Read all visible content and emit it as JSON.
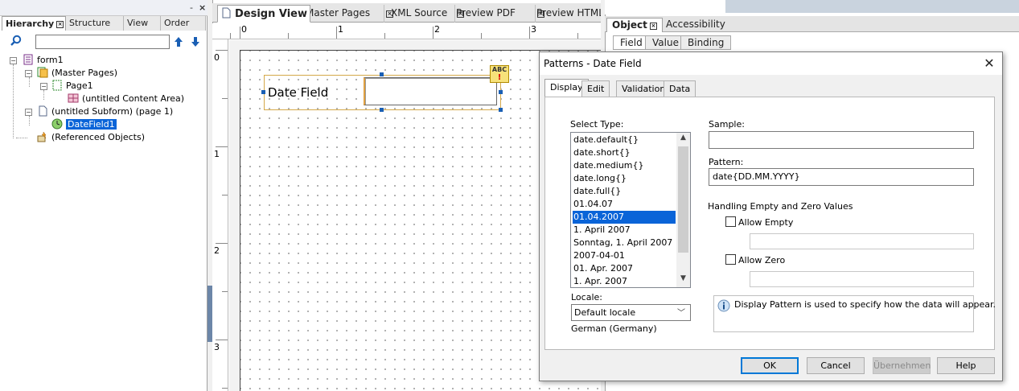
{
  "hierarchy_panel": {
    "tabs": [
      {
        "label": "Hierarchy"
      },
      {
        "label": "Structure"
      },
      {
        "label": "View"
      },
      {
        "label": "Order"
      }
    ],
    "minimize_label": "-",
    "close_label": "×",
    "tree": [
      {
        "label": "form1"
      },
      {
        "label": "(Master Pages)"
      },
      {
        "label": "Page1"
      },
      {
        "label": "(untitled Content Area)"
      },
      {
        "label": "(untitled Subform) (page 1)"
      },
      {
        "label": "DateField1"
      },
      {
        "label": "(Referenced Objects)"
      }
    ]
  },
  "design_panel": {
    "tabs": [
      {
        "label": "Design View"
      },
      {
        "label": "Master Pages"
      },
      {
        "label": "XML Source"
      },
      {
        "label": "Preview PDF"
      },
      {
        "label": "Preview HTML"
      }
    ],
    "ruler_h_labels": [
      "0",
      "1",
      "2",
      "3"
    ],
    "ruler_v_labels": [
      "0",
      "1",
      "2",
      "3"
    ],
    "field_caption": "Date Field",
    "badge_text": "ABC"
  },
  "object_panel": {
    "tabs": [
      {
        "label": "Object"
      },
      {
        "label": "Accessibility"
      }
    ],
    "subtabs": [
      {
        "label": "Field"
      },
      {
        "label": "Value"
      },
      {
        "label": "Binding"
      }
    ]
  },
  "dialog": {
    "title": "Patterns - Date Field",
    "close_label": "✕",
    "tabs": [
      {
        "label": "Display"
      },
      {
        "label": "Edit"
      },
      {
        "label": "Validation"
      },
      {
        "label": "Data"
      }
    ],
    "select_type_label": "Select Type:",
    "type_options": [
      "date.default{}",
      "date.short{}",
      "date.medium{}",
      "date.long{}",
      "date.full{}",
      "01.04.07",
      "01.04.2007",
      "1. April 2007",
      "Sonntag, 1. April 2007",
      "2007-04-01",
      "01. Apr. 2007",
      "1. Apr. 2007"
    ],
    "selected_type": "01.04.2007",
    "locale_label": "Locale:",
    "locale_value": "Default locale",
    "locale_detail": "German (Germany)",
    "sample_label": "Sample:",
    "sample_value": "",
    "pattern_label": "Pattern:",
    "pattern_value": "date{DD.MM.YYYY}",
    "handling_label": "Handling Empty and Zero Values",
    "allow_empty_label": "Allow Empty",
    "allow_empty_checked": false,
    "allow_zero_label": "Allow Zero",
    "allow_zero_checked": false,
    "info_text": "Display Pattern is used to specify how the data will appear.",
    "buttons": {
      "ok": "OK",
      "cancel": "Cancel",
      "apply": "Übernehmen",
      "help": "Help"
    }
  }
}
